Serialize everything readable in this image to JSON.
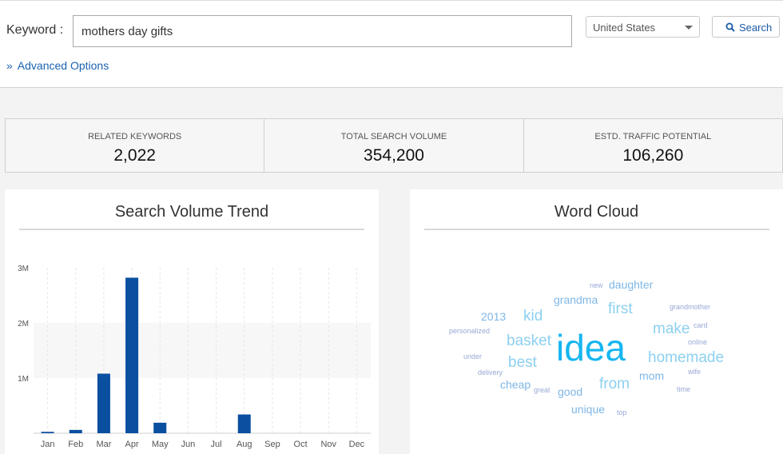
{
  "search": {
    "label": "Keyword :",
    "value": "mothers day gifts",
    "country": "United States",
    "button": "Search",
    "advanced": "Advanced Options"
  },
  "stats": [
    {
      "title": "RELATED KEYWORDS",
      "value": "2,022"
    },
    {
      "title": "TOTAL SEARCH VOLUME",
      "value": "354,200"
    },
    {
      "title": "ESTD. TRAFFIC POTENTIAL",
      "value": "106,260"
    }
  ],
  "trend": {
    "title": "Search Volume Trend"
  },
  "cloud": {
    "title": "Word Cloud",
    "words": [
      {
        "text": "idea",
        "size": 46,
        "color": "#16b6f0"
      },
      {
        "text": "daughter",
        "size": 14,
        "color": "#7fb6e6"
      },
      {
        "text": "new",
        "size": 9,
        "color": "#9aa9d6"
      },
      {
        "text": "grandma",
        "size": 14,
        "color": "#7fb6e6"
      },
      {
        "text": "first",
        "size": 19,
        "color": "#8cd0ef"
      },
      {
        "text": "grandmother",
        "size": 9,
        "color": "#9aa9d6"
      },
      {
        "text": "2013",
        "size": 14,
        "color": "#7fb6e6"
      },
      {
        "text": "kid",
        "size": 19,
        "color": "#8cd0ef"
      },
      {
        "text": "make",
        "size": 19,
        "color": "#8cd0ef"
      },
      {
        "text": "card",
        "size": 9,
        "color": "#9aa9d6"
      },
      {
        "text": "personalized",
        "size": 9,
        "color": "#9aa9d6"
      },
      {
        "text": "basket",
        "size": 19,
        "color": "#8cd0ef"
      },
      {
        "text": "online",
        "size": 9,
        "color": "#9aa9d6"
      },
      {
        "text": "homemade",
        "size": 19,
        "color": "#8cd0ef"
      },
      {
        "text": "under",
        "size": 9,
        "color": "#9aa9d6"
      },
      {
        "text": "best",
        "size": 19,
        "color": "#8cd0ef"
      },
      {
        "text": "delivery",
        "size": 9,
        "color": "#9aa9d6"
      },
      {
        "text": "mom",
        "size": 14,
        "color": "#7fb6e6"
      },
      {
        "text": "wife",
        "size": 9,
        "color": "#9aa9d6"
      },
      {
        "text": "cheap",
        "size": 14,
        "color": "#7fb6e6"
      },
      {
        "text": "from",
        "size": 19,
        "color": "#8cd0ef"
      },
      {
        "text": "great",
        "size": 9,
        "color": "#9aa9d6"
      },
      {
        "text": "good",
        "size": 14,
        "color": "#7fb6e6"
      },
      {
        "text": "time",
        "size": 9,
        "color": "#9aa9d6"
      },
      {
        "text": "unique",
        "size": 14,
        "color": "#7fb6e6"
      },
      {
        "text": "top",
        "size": 9,
        "color": "#9aa9d6"
      }
    ]
  },
  "colors": {
    "bar": "#0a4fa0",
    "link": "#1a62b0"
  },
  "chart_data": {
    "type": "bar",
    "categories": [
      "Jan",
      "Feb",
      "Mar",
      "Apr",
      "May",
      "Jun",
      "Jul",
      "Aug",
      "Sep",
      "Oct",
      "Nov",
      "Dec"
    ],
    "values": [
      25000,
      60000,
      1080000,
      2820000,
      190000,
      0,
      0,
      340000,
      0,
      0,
      0,
      0
    ],
    "ylim": [
      0,
      3000000
    ],
    "yticks": [
      {
        "value": 1000000,
        "label": "1M"
      },
      {
        "value": 2000000,
        "label": "2M"
      },
      {
        "value": 3000000,
        "label": "3M"
      }
    ],
    "grid": true
  }
}
